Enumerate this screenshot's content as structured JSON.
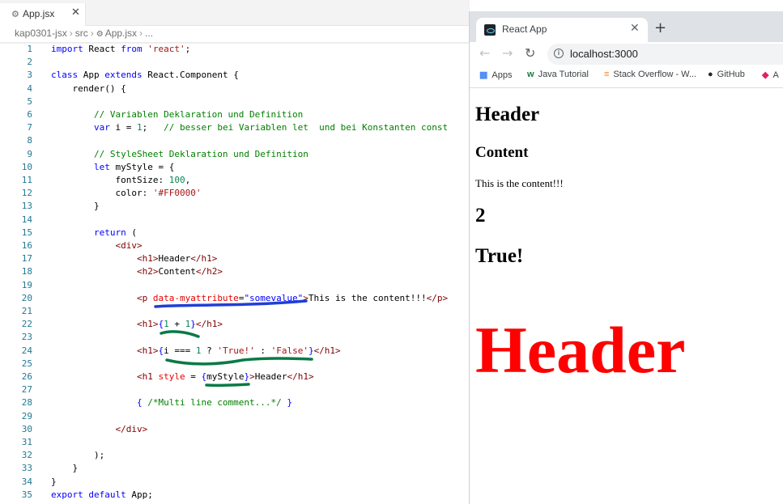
{
  "editor": {
    "tab": {
      "label": "App.jsx",
      "icon": "gear-icon",
      "close": "✕"
    },
    "breadcrumb": [
      "kap0301-jsx",
      "src",
      "App.jsx",
      "..."
    ],
    "lines": [
      [
        [
          "k",
          "import"
        ],
        [
          "plain",
          " React "
        ],
        [
          "k",
          "from"
        ],
        [
          "plain",
          " "
        ],
        [
          "s",
          "'react'"
        ],
        [
          "plain",
          ";"
        ]
      ],
      [],
      [
        [
          "k",
          "class"
        ],
        [
          "plain",
          " App "
        ],
        [
          "k",
          "extends"
        ],
        [
          "plain",
          " React.Component {"
        ]
      ],
      [
        [
          "plain",
          "    render() {"
        ]
      ],
      [],
      [
        [
          "plain",
          "        "
        ],
        [
          "c",
          "// Variablen Deklaration und Definition"
        ]
      ],
      [
        [
          "plain",
          "        "
        ],
        [
          "k",
          "var"
        ],
        [
          "plain",
          " i = "
        ],
        [
          "n",
          "1"
        ],
        [
          "plain",
          ";   "
        ],
        [
          "c",
          "// besser bei Variablen let  und bei Konstanten const"
        ]
      ],
      [],
      [
        [
          "plain",
          "        "
        ],
        [
          "c",
          "// StyleSheet Deklaration und Definition"
        ]
      ],
      [
        [
          "plain",
          "        "
        ],
        [
          "k",
          "let"
        ],
        [
          "plain",
          " myStyle = {"
        ]
      ],
      [
        [
          "plain",
          "            fontSize: "
        ],
        [
          "n",
          "100"
        ],
        [
          "plain",
          ","
        ]
      ],
      [
        [
          "plain",
          "            color: "
        ],
        [
          "s",
          "'#FF0000'"
        ]
      ],
      [
        [
          "plain",
          "        }"
        ]
      ],
      [],
      [
        [
          "plain",
          "        "
        ],
        [
          "k",
          "return"
        ],
        [
          "plain",
          " ("
        ]
      ],
      [
        [
          "plain",
          "            "
        ],
        [
          "tag",
          "<div>"
        ]
      ],
      [
        [
          "plain",
          "                "
        ],
        [
          "tag",
          "<h1>"
        ],
        [
          "plain",
          "Header"
        ],
        [
          "tag",
          "</h1>"
        ]
      ],
      [
        [
          "plain",
          "                "
        ],
        [
          "tag",
          "<h2>"
        ],
        [
          "plain",
          "Content"
        ],
        [
          "tag",
          "</h2>"
        ]
      ],
      [],
      [
        [
          "plain",
          "                "
        ],
        [
          "tag",
          "<p "
        ],
        [
          "attr",
          "data-myattribute"
        ],
        [
          "plain",
          "="
        ],
        [
          "k",
          "\"somevalue\""
        ],
        [
          "tag",
          ">"
        ],
        [
          "plain",
          "This is the content!!!"
        ],
        [
          "tag",
          "</p>"
        ]
      ],
      [],
      [
        [
          "plain",
          "                "
        ],
        [
          "tag",
          "<h1>"
        ],
        [
          "k",
          "{"
        ],
        [
          "n",
          "1"
        ],
        [
          "plain",
          " + "
        ],
        [
          "n",
          "1"
        ],
        [
          "k",
          "}"
        ],
        [
          "tag",
          "</h1>"
        ]
      ],
      [],
      [
        [
          "plain",
          "                "
        ],
        [
          "tag",
          "<h1>"
        ],
        [
          "k",
          "{"
        ],
        [
          "plain",
          "i === "
        ],
        [
          "n",
          "1"
        ],
        [
          "plain",
          " ? "
        ],
        [
          "s",
          "'True!'"
        ],
        [
          "plain",
          " : "
        ],
        [
          "s",
          "'False'"
        ],
        [
          "k",
          "}"
        ],
        [
          "tag",
          "</h1>"
        ]
      ],
      [],
      [
        [
          "plain",
          "                "
        ],
        [
          "tag",
          "<h1 "
        ],
        [
          "attr",
          "style"
        ],
        [
          "plain",
          " = "
        ],
        [
          "k",
          "{"
        ],
        [
          "plain",
          "myStyle"
        ],
        [
          "k",
          "}"
        ],
        [
          "tag",
          ">"
        ],
        [
          "plain",
          "Header"
        ],
        [
          "tag",
          "</h1>"
        ]
      ],
      [],
      [
        [
          "plain",
          "                "
        ],
        [
          "k",
          "{"
        ],
        [
          "c",
          " /*Multi line comment...*/ "
        ],
        [
          "k",
          "}"
        ]
      ],
      [],
      [
        [
          "plain",
          "            "
        ],
        [
          "tag",
          "</div>"
        ]
      ],
      [],
      [
        [
          "plain",
          "        );"
        ]
      ],
      [
        [
          "plain",
          "    }"
        ]
      ],
      [
        [
          "plain",
          "}"
        ]
      ],
      [
        [
          "k",
          "export"
        ],
        [
          "plain",
          " "
        ],
        [
          "k",
          "default"
        ],
        [
          "plain",
          " App;"
        ]
      ]
    ],
    "annotation_colors": {
      "blue": "#1f3fd6",
      "green": "#0a7a45"
    }
  },
  "browser": {
    "tab_title": "React App",
    "tab_close": "✕",
    "new_tab": "+",
    "url": "localhost:3000",
    "bookmarks": [
      {
        "label": "Apps",
        "icon": "apps-grid-icon"
      },
      {
        "label": "Java Tutorial",
        "icon": "w-icon"
      },
      {
        "label": "Stack Overflow - W...",
        "icon": "stackoverflow-icon"
      },
      {
        "label": "GitHub",
        "icon": "github-icon"
      },
      {
        "label": "A",
        "icon": "bookmark-icon"
      }
    ],
    "page": {
      "h1_header": "Header",
      "h2_content": "Content",
      "paragraph": "This is the content!!!",
      "h1_sum": "2",
      "h1_ternary": "True!",
      "styled_header": "Header",
      "styled_header_color": "#FF0000"
    }
  }
}
